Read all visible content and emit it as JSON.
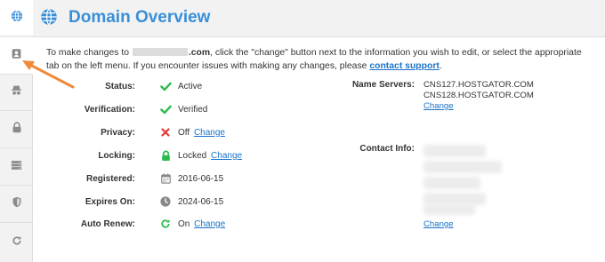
{
  "header": {
    "title": "Domain Overview"
  },
  "sidebar": {
    "items": [
      {
        "icon": "globe-icon"
      },
      {
        "icon": "contact-card-icon"
      },
      {
        "icon": "privacy-spy-icon"
      },
      {
        "icon": "lock-icon"
      },
      {
        "icon": "server-icon"
      },
      {
        "icon": "shield-icon"
      },
      {
        "icon": "renew-icon"
      }
    ]
  },
  "intro": {
    "part1": "To make changes to",
    "domain_suffix": ".com",
    "part2": ", click the \"change\" button next to the information you wish to edit, or select the appropriate tab on the left menu. If you encounter issues with making any changes, please",
    "link": "contact support",
    "end": "."
  },
  "details": [
    {
      "label": "Status:",
      "icon": "check-icon",
      "value": "Active",
      "change": ""
    },
    {
      "label": "Verification:",
      "icon": "check-icon",
      "value": "Verified",
      "change": ""
    },
    {
      "label": "Privacy:",
      "icon": "x-icon",
      "value": "Off",
      "change": "Change"
    },
    {
      "label": "Locking:",
      "icon": "lock-icon",
      "value": "Locked",
      "change": "Change"
    },
    {
      "label": "Registered:",
      "icon": "calendar-icon",
      "value": "2016-06-15",
      "change": ""
    },
    {
      "label": "Expires On:",
      "icon": "clock-icon",
      "value": "2024-06-15",
      "change": ""
    },
    {
      "label": "Auto Renew:",
      "icon": "refresh-icon",
      "value": "On",
      "change": "Change"
    }
  ],
  "nameservers": {
    "label": "Name Servers:",
    "ns1": "CNS127.HOSTGATOR.COM",
    "ns2": "CNS128.HOSTGATOR.COM",
    "change": "Change"
  },
  "contact": {
    "label": "Contact Info:",
    "change": "Change"
  },
  "colors": {
    "accent": "#3a8fd8",
    "link": "#1a73c8",
    "success": "#2dbb4e",
    "danger": "#e53935",
    "annotation": "#f08a3a"
  }
}
